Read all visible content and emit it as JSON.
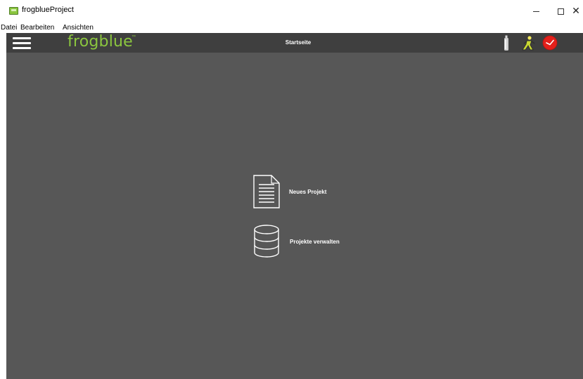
{
  "window": {
    "title": "frogblueProject",
    "controls": {
      "minimize": "minimize-icon",
      "maximize": "maximize-icon",
      "close": "✕"
    }
  },
  "menu": {
    "items": [
      {
        "label": "Datei"
      },
      {
        "label": "Bearbeiten"
      },
      {
        "label": "Ansichten"
      }
    ]
  },
  "header": {
    "logo": "frogblue",
    "logo_tm": "™",
    "title": "Startseite",
    "icons": [
      "hamburger-menu-icon",
      "bottle-icon",
      "person-icon",
      "clock-icon"
    ],
    "colors": {
      "brand": "#8bc63f",
      "header_bg": "#3f3f3f",
      "main_bg": "#575757",
      "clock": "#e3201b"
    }
  },
  "main": {
    "actions": [
      {
        "label": "Neues Projekt",
        "icon": "document-icon"
      },
      {
        "label": "Projekte verwalten",
        "icon": "database-icon"
      }
    ]
  }
}
